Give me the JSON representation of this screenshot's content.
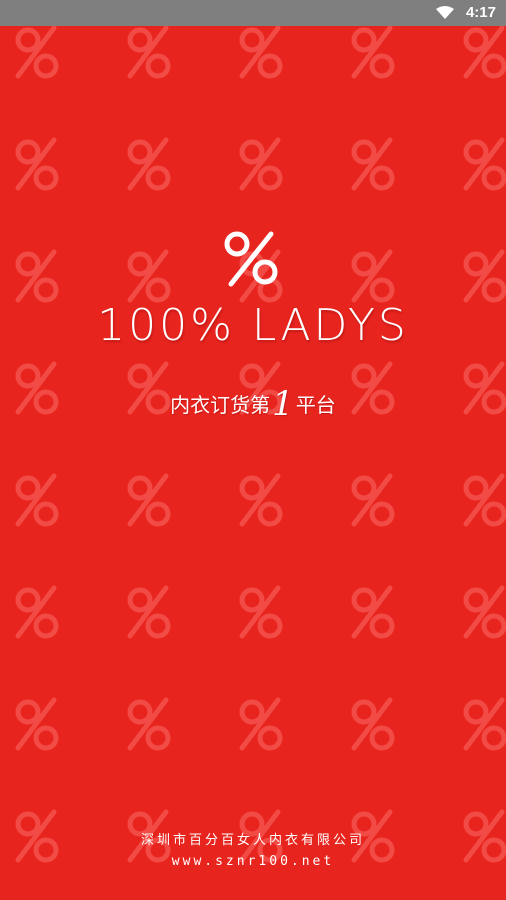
{
  "status_bar": {
    "time": "4:17",
    "icons": [
      "wifi-icon"
    ]
  },
  "splash": {
    "logo_symbol": "%",
    "brand_name": "100% LADYS",
    "tagline_before": "内衣订货第",
    "tagline_number": "1",
    "tagline_after": "平台",
    "company": "深圳市百分百女人内衣有限公司",
    "website": "www.sznr100.net"
  },
  "colors": {
    "background": "#E8241F",
    "pattern": "#F24B45",
    "status_bar": "#7F7F7F",
    "text": "#FFFFFF"
  }
}
